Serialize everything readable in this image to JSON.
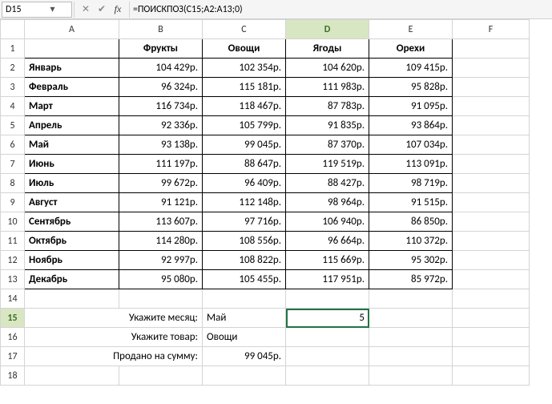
{
  "namebox": "D15",
  "formula": "=ПОИСКПОЗ(C15;A2:A13;0)",
  "columns": [
    "A",
    "B",
    "C",
    "D",
    "E",
    "F"
  ],
  "active_col": "D",
  "active_row": 15,
  "headers": {
    "b": "Фрукты",
    "c": "Овощи",
    "d": "Ягоды",
    "e": "Орехи"
  },
  "months": [
    "Январь",
    "Февраль",
    "Март",
    "Апрель",
    "Май",
    "Июнь",
    "Июль",
    "Август",
    "Сентябрь",
    "Октябрь",
    "Ноябрь",
    "Декабрь"
  ],
  "data": {
    "r2": {
      "b": "104 429р.",
      "c": "102 354р.",
      "d": "104 620р.",
      "e": "109 415р."
    },
    "r3": {
      "b": "96 324р.",
      "c": "115 181р.",
      "d": "111 983р.",
      "e": "95 828р."
    },
    "r4": {
      "b": "116 734р.",
      "c": "118 467р.",
      "d": "87 783р.",
      "e": "91 095р."
    },
    "r5": {
      "b": "92 336р.",
      "c": "105 799р.",
      "d": "91 835р.",
      "e": "93 864р."
    },
    "r6": {
      "b": "93 138р.",
      "c": "99 045р.",
      "d": "87 370р.",
      "e": "107 034р."
    },
    "r7": {
      "b": "111 197р.",
      "c": "88 647р.",
      "d": "119 519р.",
      "e": "113 091р."
    },
    "r8": {
      "b": "99 672р.",
      "c": "96 409р.",
      "d": "88 427р.",
      "e": "98 719р."
    },
    "r9": {
      "b": "91 121р.",
      "c": "112 148р.",
      "d": "98 964р.",
      "e": "91 515р."
    },
    "r10": {
      "b": "113 607р.",
      "c": "97 716р.",
      "d": "106 940р.",
      "e": "86 850р."
    },
    "r11": {
      "b": "114 280р.",
      "c": "108 556р.",
      "d": "96 664р.",
      "e": "110 372р."
    },
    "r12": {
      "b": "92 997р.",
      "c": "108 822р.",
      "d": "115 669р.",
      "e": "95 302р."
    },
    "r13": {
      "b": "95 080р.",
      "c": "105 455р.",
      "d": "117 951р.",
      "e": "85 972р."
    }
  },
  "lookup": {
    "month_label": "Укажите месяц:",
    "month_value": "Май",
    "month_result": "5",
    "prod_label": "Укажите товар:",
    "prod_value": "Овощи",
    "sum_label": "Продано на сумму:",
    "sum_value": "99 045р."
  },
  "chart_data": {
    "type": "table",
    "categories": [
      "Январь",
      "Февраль",
      "Март",
      "Апрель",
      "Май",
      "Июнь",
      "Июль",
      "Август",
      "Сентябрь",
      "Октябрь",
      "Ноябрь",
      "Декабрь"
    ],
    "series": [
      {
        "name": "Фрукты",
        "values": [
          104429,
          96324,
          116734,
          92336,
          93138,
          111197,
          99672,
          91121,
          113607,
          114280,
          92997,
          95080
        ]
      },
      {
        "name": "Овощи",
        "values": [
          102354,
          115181,
          118467,
          105799,
          99045,
          88647,
          96409,
          112148,
          97716,
          108556,
          108822,
          105455
        ]
      },
      {
        "name": "Ягоды",
        "values": [
          104620,
          111983,
          87783,
          91835,
          87370,
          119519,
          88427,
          98964,
          106940,
          96664,
          115669,
          117951
        ]
      },
      {
        "name": "Орехи",
        "values": [
          109415,
          95828,
          91095,
          93864,
          107034,
          113091,
          98719,
          91515,
          86850,
          110372,
          95302,
          85972
        ]
      }
    ],
    "unit": "р."
  }
}
